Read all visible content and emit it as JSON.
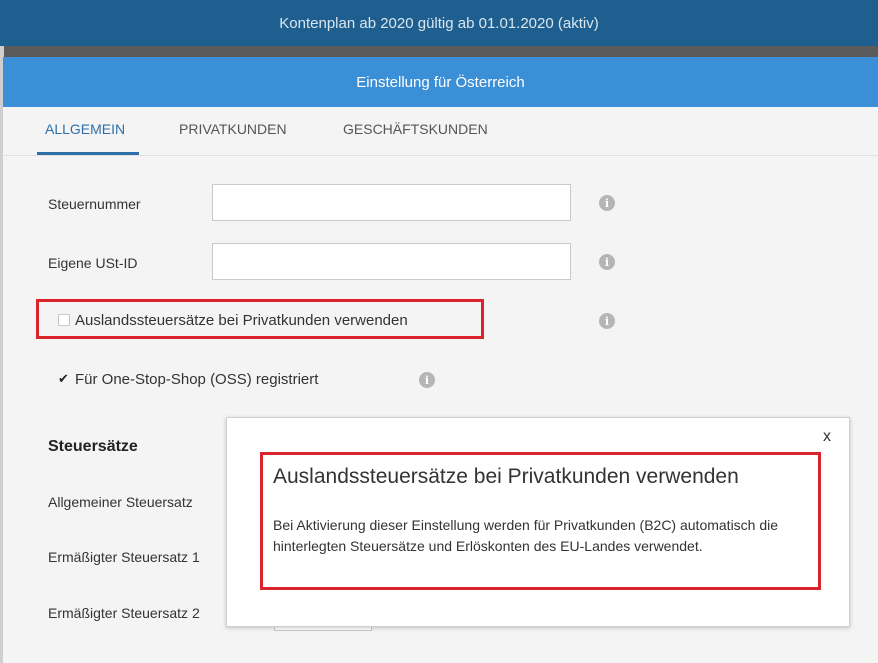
{
  "topbar": {
    "title": "Kontenplan ab 2020 gültig ab 01.01.2020 (aktiv)"
  },
  "dialog": {
    "title": "Einstellung für Österreich",
    "tabs": [
      {
        "label": "ALLGEMEIN",
        "active": true
      },
      {
        "label": "PRIVATKUNDEN",
        "active": false
      },
      {
        "label": "GESCHÄFTSKUNDEN",
        "active": false
      }
    ],
    "fields": {
      "steuernummer": {
        "label": "Steuernummer",
        "value": ""
      },
      "ust_id": {
        "label": "Eigene USt-ID",
        "value": ""
      }
    },
    "checkboxes": {
      "auslands": {
        "label": "Auslandssteuersätze bei Privatkunden verwenden",
        "checked": false
      },
      "oss": {
        "label": "Für One-Stop-Shop (OSS) registriert",
        "checked": true
      }
    },
    "steuersaetze": {
      "heading": "Steuersätze",
      "allgemein": "Allgemeiner Steuersatz",
      "ermaessigt1": "Ermäßigter Steuersatz 1",
      "ermaessigt2": "Ermäßigter Steuersatz 2"
    }
  },
  "tooltip": {
    "close": "x",
    "title": "Auslandssteuersätze bei Privatkunden verwenden",
    "text": "Bei Aktivierung dieser Einstellung werden für Privatkunden (B2C) automatisch die hinterlegten Steuersätze und Erlöskonten des EU-Landes verwendet."
  },
  "colors": {
    "topbar": "#1f5f8f",
    "dialog_header": "#3b8fd6",
    "accent": "#2e6fa8",
    "highlight": "#d9232d"
  }
}
